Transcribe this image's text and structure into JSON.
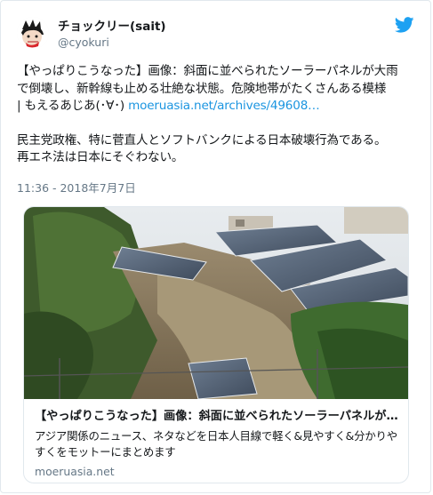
{
  "tweet": {
    "author": {
      "display_name": "チョックリー(sait)",
      "handle": "@cyokuri"
    },
    "text": {
      "line1": "【やっぱりこうなった】画像：斜面に並べられたソーラーパネルが大雨",
      "line2": "で倒壊し、新幹線も止める壮絶な状態。危険地帯がたくさんある模様",
      "line3_prefix": "| もえるあじあ(･∀･)",
      "line3_link": "moeruasia.net/archives/49608…",
      "para2_line1": "民主党政権、特に菅直人とソフトバンクによる日本破壊行為である。",
      "para2_line2": "再エネ法は日本にそぐわない。"
    },
    "timestamp": "11:36 - 2018年7月7日"
  },
  "card": {
    "title": "【やっぱりこうなった】画像：斜面に並べられたソーラーパネルが大雨…",
    "description_line1": "アジア関係のニュース、ネタなどを日本人目線で軽く&見やすく&分かりや",
    "description_line2": "すくをモットーにまとめます",
    "domain": "moeruasia.net"
  },
  "colors": {
    "link": "#1b95e0",
    "twitter_blue": "#1da1f2",
    "secondary_text": "#657786",
    "border": "#e1e8ed"
  },
  "icons": {
    "brand": "twitter-bird-icon",
    "avatar": "cartoon-avatar"
  }
}
